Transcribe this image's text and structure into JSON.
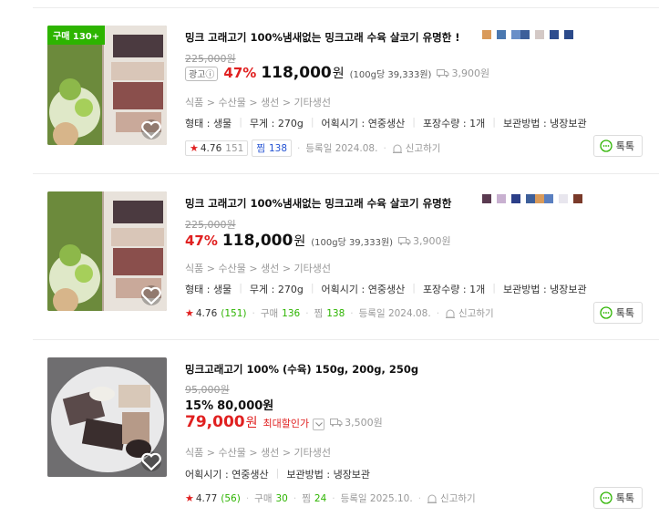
{
  "items": [
    {
      "badge": "구매 130+",
      "title": "밍크 고래고기 100%냄새없는 밍크고래 수육 살코기 유명한 !",
      "original_price": "225,000원",
      "ad_label": "광고ⓘ",
      "discount": "47%",
      "price": "118,000",
      "won": "원",
      "unit_price": "(100g당 39,333원)",
      "shipping": "3,900원",
      "category": [
        "식품",
        "수산물",
        "생선",
        "기타생선"
      ],
      "specs": [
        "형태 : 생물",
        "무게 : 270g",
        "어획시기 : 연중생산",
        "포장수량 : 1개",
        "보관방법 : 냉장보관"
      ],
      "rating": "4.76",
      "review_count": "151",
      "zzim_label": "찜",
      "zzim_count": "138",
      "registered": "등록일 2024.08.",
      "report": "신고하기",
      "talk": "톡톡"
    },
    {
      "title": "밍크 고래고기 100%냄새없는 밍크고래 수육 살코기 유명한",
      "original_price": "225,000원",
      "discount": "47%",
      "price": "118,000",
      "won": "원",
      "unit_price": "(100g당 39,333원)",
      "shipping": "3,900원",
      "category": [
        "식품",
        "수산물",
        "생선",
        "기타생선"
      ],
      "specs": [
        "형태 : 생물",
        "무게 : 270g",
        "어획시기 : 연중생산",
        "포장수량 : 1개",
        "보관방법 : 냉장보관"
      ],
      "rating": "4.76",
      "review_count": "(151)",
      "purchase_label": "구매",
      "purchase_count": "136",
      "zzim_label": "찜",
      "zzim_count": "138",
      "registered": "등록일 2024.08.",
      "report": "신고하기",
      "talk": "톡톡"
    },
    {
      "title": "밍크고래고기 100% (수육) 150g, 200g, 250g",
      "original_price": "95,000원",
      "discount": "15%",
      "price": "80,000원",
      "sale_price": "79,000",
      "won": "원",
      "max_discount": "최대할인가",
      "shipping": "3,500원",
      "category": [
        "식품",
        "수산물",
        "생선",
        "기타생선"
      ],
      "specs": [
        "어획시기 : 연중생산",
        "보관방법 : 냉장보관"
      ],
      "rating": "4.77",
      "review_count": "(56)",
      "purchase_label": "구매",
      "purchase_count": "30",
      "zzim_label": "찜",
      "zzim_count": "24",
      "registered": "등록일 2025.10.",
      "report": "신고하기",
      "talk": "톡톡"
    }
  ],
  "colors": {
    "accent_red": "#e02020",
    "green": "#2db400",
    "zzim_blue": "#2453d3"
  },
  "icons": [
    "heart-icon",
    "truck-icon",
    "bell-report-icon",
    "talk-bubble-icon",
    "star-icon",
    "chevron-down-icon"
  ]
}
